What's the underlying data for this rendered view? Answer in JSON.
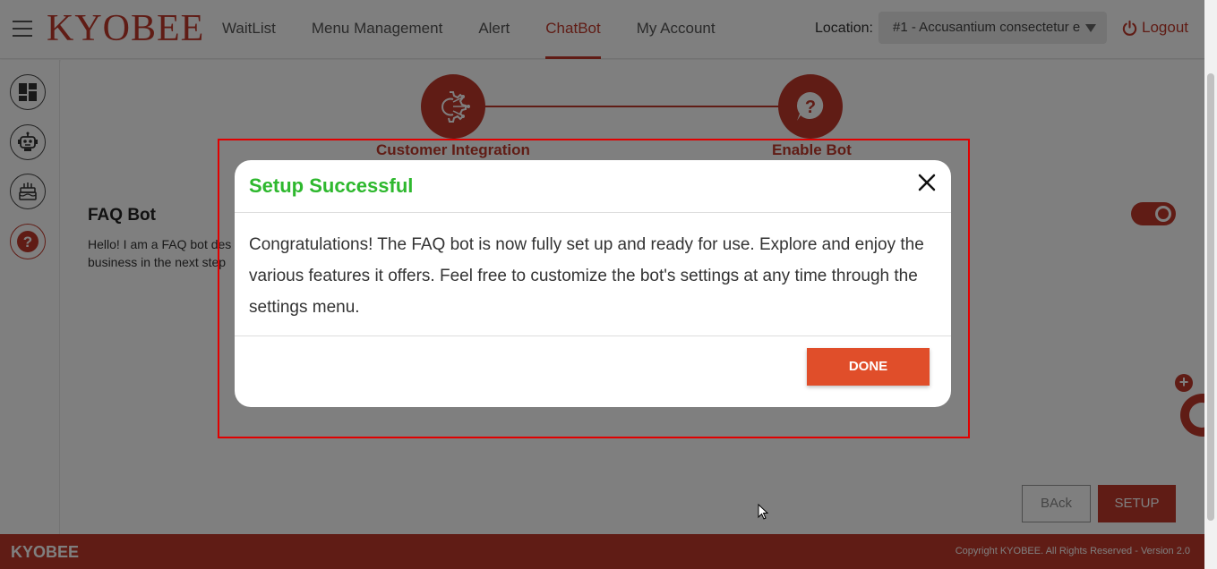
{
  "header": {
    "logo": "KYOBEE",
    "nav": [
      {
        "label": "WaitList"
      },
      {
        "label": "Menu Management"
      },
      {
        "label": "Alert"
      },
      {
        "label": "ChatBot",
        "active": true
      },
      {
        "label": "My Account"
      }
    ],
    "location_label": "Location:",
    "location_value": "#1 - Accusantium consectetur e",
    "logout_label": "Logout"
  },
  "sidebar": {
    "icons": [
      "dashboard-icon",
      "robot-icon",
      "cake-icon",
      "question-icon"
    ]
  },
  "main": {
    "steps": [
      {
        "label": "Customer Integration",
        "icon": "gear-network-icon"
      },
      {
        "label": "Enable Bot",
        "icon": "question-bubble-icon"
      }
    ],
    "faq_title": "FAQ Bot",
    "faq_desc_line1": "Hello! I am a FAQ bot des",
    "faq_desc_line2": "business in the next step",
    "toggle_on": true,
    "back_label": "BAck",
    "setup_label": "SETUP"
  },
  "modal": {
    "title": "Setup Successful",
    "body": "Congratulations! The FAQ bot is now fully set up and ready for use. Explore and enjoy the various features it offers. Feel free to customize the bot's settings at any time through the settings menu.",
    "done_label": "DONE"
  },
  "footer": {
    "logo": "KYOBEE",
    "copyright": "Copyright KYOBEE. All Rights Reserved - Version 2.0"
  },
  "colors": {
    "brand": "#c0392b",
    "success": "#2eb82e",
    "done_button": "#e04e2a"
  }
}
